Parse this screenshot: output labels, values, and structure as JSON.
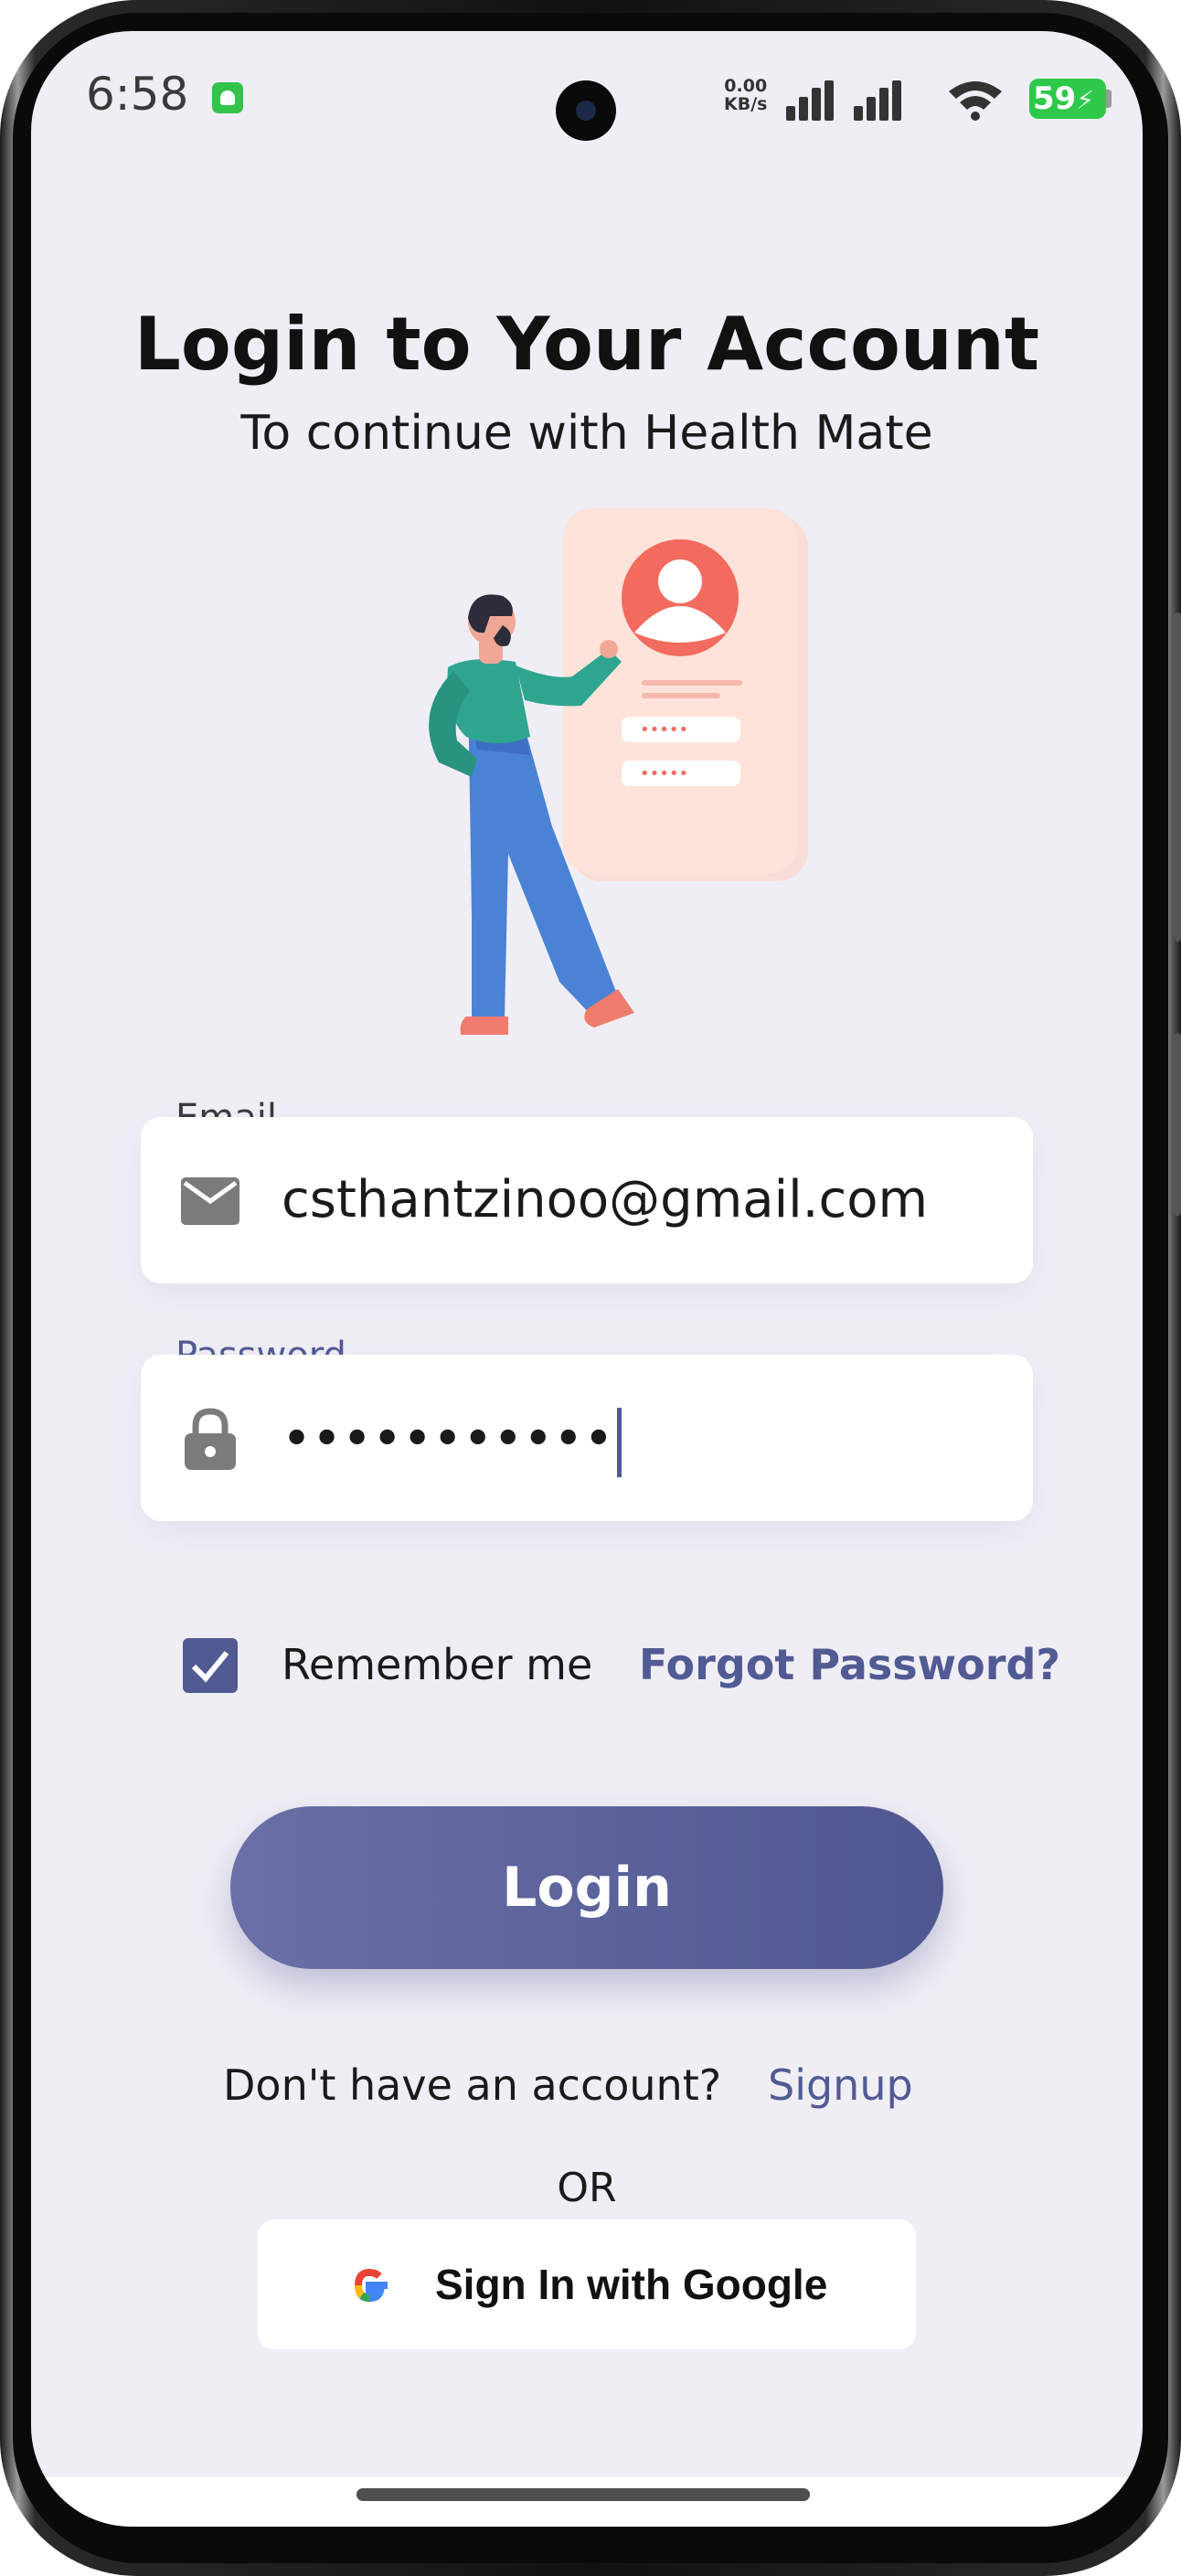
{
  "status_bar": {
    "time": "6:58",
    "net_speed_value": "0.00",
    "net_speed_unit": "KB/s",
    "battery": "59"
  },
  "header": {
    "title": "Login to Your Account",
    "subtitle": "To continue with Health Mate"
  },
  "form": {
    "email_label": "Email",
    "email_value": "csthantzinoo@gmail.com",
    "password_label": "Password",
    "password_value": "•••••••••••",
    "remember_label": "Remember me",
    "remember_checked": true,
    "forgot_label": "Forgot Password?",
    "login_label": "Login"
  },
  "footer": {
    "no_account_text": "Don't have an account?",
    "signup_label": "Signup",
    "or_text": "OR",
    "google_label": "Sign In with Google"
  },
  "colors": {
    "accent": "#525a94",
    "background": "#f0eef5",
    "battery": "#2ec94a"
  }
}
